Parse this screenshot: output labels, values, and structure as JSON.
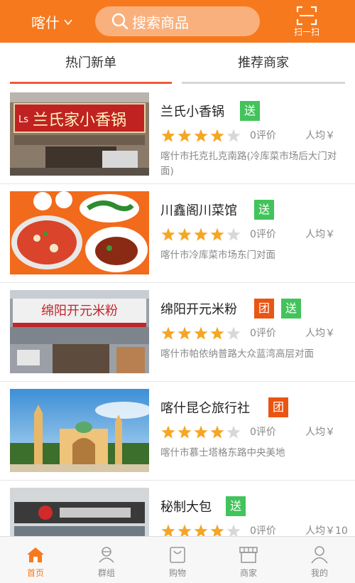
{
  "header": {
    "city": "喀什",
    "search_placeholder": "搜索商品",
    "scan_label": "扫一扫"
  },
  "tabs": [
    {
      "label": "热门新单",
      "active": true
    },
    {
      "label": "推荐商家",
      "active": false
    }
  ],
  "colors": {
    "brand": "#f7791e",
    "star": "#f5a623",
    "badge_delivery": "#43c35b",
    "badge_group": "#ea5513"
  },
  "merchants": [
    {
      "name": "兰氏小香锅",
      "badges": [
        {
          "label": "送",
          "type": "delivery"
        }
      ],
      "rating": 4,
      "reviews": "0评价",
      "avg_price": "人均￥",
      "address": "喀什市托克扎克南路(冷库菜市场后大门对面)",
      "thumb_icon": "storefront-sign-photo",
      "sign_text": "兰氏家小香锅"
    },
    {
      "name": "川鑫阁川菜馆",
      "badges": [
        {
          "label": "送",
          "type": "delivery"
        }
      ],
      "rating": 4,
      "reviews": "0评价",
      "avg_price": "人均￥",
      "address": "喀什市冷库菜市场东门对面",
      "thumb_icon": "sichuan-dishes-photo"
    },
    {
      "name": "绵阳开元米粉",
      "badges": [
        {
          "label": "团",
          "type": "group"
        },
        {
          "label": "送",
          "type": "delivery"
        }
      ],
      "rating": 4,
      "reviews": "0评价",
      "avg_price": "人均￥",
      "address": "喀什市帕依纳普路大众蓝湾高层对面",
      "thumb_icon": "rice-noodle-shop-photo",
      "sign_text": "绵阳开元米粉"
    },
    {
      "name": "喀什昆仑旅行社",
      "badges": [
        {
          "label": "团",
          "type": "group"
        }
      ],
      "rating": 4,
      "reviews": "0评价",
      "avg_price": "人均￥",
      "address": "喀什市慕士塔格东路中央美地",
      "thumb_icon": "mosque-photo"
    },
    {
      "name": "秘制大包",
      "badges": [
        {
          "label": "送",
          "type": "delivery"
        }
      ],
      "rating": 4,
      "reviews": "0评价",
      "avg_price": "人均￥10",
      "address": "",
      "thumb_icon": "bun-shop-photo"
    }
  ],
  "bottom_nav": [
    {
      "label": "首页",
      "icon": "home-icon",
      "active": true
    },
    {
      "label": "群组",
      "icon": "group-icon",
      "active": false
    },
    {
      "label": "购物",
      "icon": "shopping-bag-icon",
      "active": false
    },
    {
      "label": "商家",
      "icon": "store-icon",
      "active": false
    },
    {
      "label": "我的",
      "icon": "user-icon",
      "active": false
    }
  ]
}
